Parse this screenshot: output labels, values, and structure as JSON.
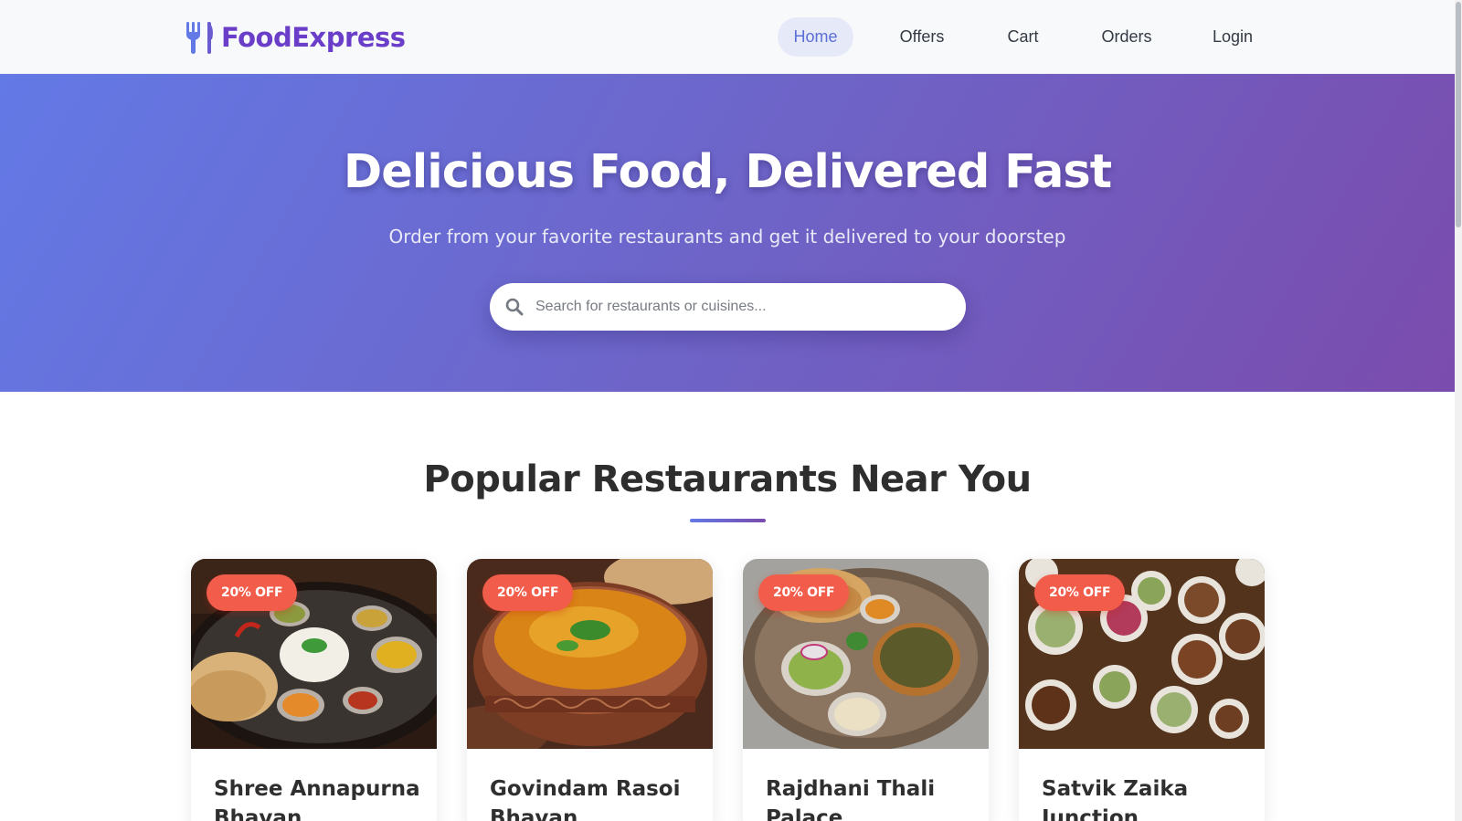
{
  "brand": {
    "name": "FoodExpress",
    "icon": "utensils-icon",
    "color": "#6a3ec9"
  },
  "nav": {
    "items": [
      {
        "label": "Home",
        "active": true
      },
      {
        "label": "Offers",
        "active": false
      },
      {
        "label": "Cart",
        "active": false
      },
      {
        "label": "Orders",
        "active": false
      },
      {
        "label": "Login",
        "active": false
      }
    ]
  },
  "hero": {
    "title": "Delicious Food, Delivered Fast",
    "subtitle": "Order from your favorite restaurants and get it delivered to your doorstep",
    "search": {
      "placeholder": "Search for restaurants or cuisines...",
      "value": "",
      "icon": "search-icon"
    },
    "gradient": [
      "#6379e6",
      "#7a4cad"
    ]
  },
  "section": {
    "title": "Popular Restaurants Near You"
  },
  "restaurants": [
    {
      "name": "Shree Annapurna Bhavan",
      "badge": "20% OFF"
    },
    {
      "name": "Govindam Rasoi Bhavan",
      "badge": "20% OFF"
    },
    {
      "name": "Rajdhani Thali Palace",
      "badge": "20% OFF"
    },
    {
      "name": "Satvik Zaika Junction",
      "badge": "20% OFF"
    }
  ],
  "colors": {
    "accent": "#5c6fd8",
    "badge": "#f25c4b"
  }
}
